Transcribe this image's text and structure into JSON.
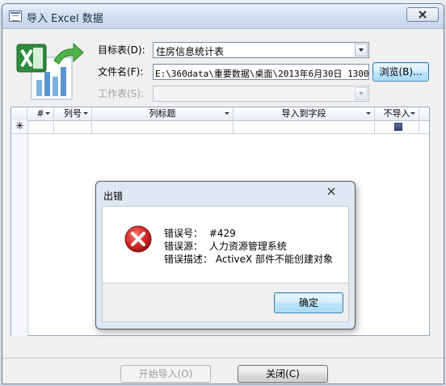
{
  "window": {
    "title": "导入 Excel 数据"
  },
  "config": {
    "target_label": "目标表(D):",
    "target_value": "住房信息统计表",
    "file_label": "文件名(F):",
    "file_value": "E:\\360data\\重要数据\\桌面\\2013年6月30日 1300",
    "browse_label": "浏览(B)...",
    "sheet_label": "工作表(S):",
    "sheet_value": ""
  },
  "grid": {
    "columns": [
      "#",
      "列号",
      "列标题",
      "导入到字段",
      "不导入"
    ],
    "new_row_marker": "✳"
  },
  "buttons": {
    "start_import": "开始导入(O)",
    "close": "关闭(C)"
  },
  "dialog": {
    "title": "出错",
    "error_no_label": "错误号：",
    "error_no_value": "#429",
    "error_source_label": "错误源：",
    "error_source_value": "人力资源管理系统",
    "error_desc_label": "错误描述：",
    "error_desc_value": "ActiveX 部件不能创建对象",
    "ok_label": "确定"
  },
  "colors": {
    "accent": "#3c7fb1",
    "error_red": "#c8222a",
    "excel_green": "#2e8b3a"
  },
  "icons": [
    "app-icon",
    "close-icon",
    "excel-import-icon",
    "error-icon",
    "dropdown-arrow-icon"
  ]
}
